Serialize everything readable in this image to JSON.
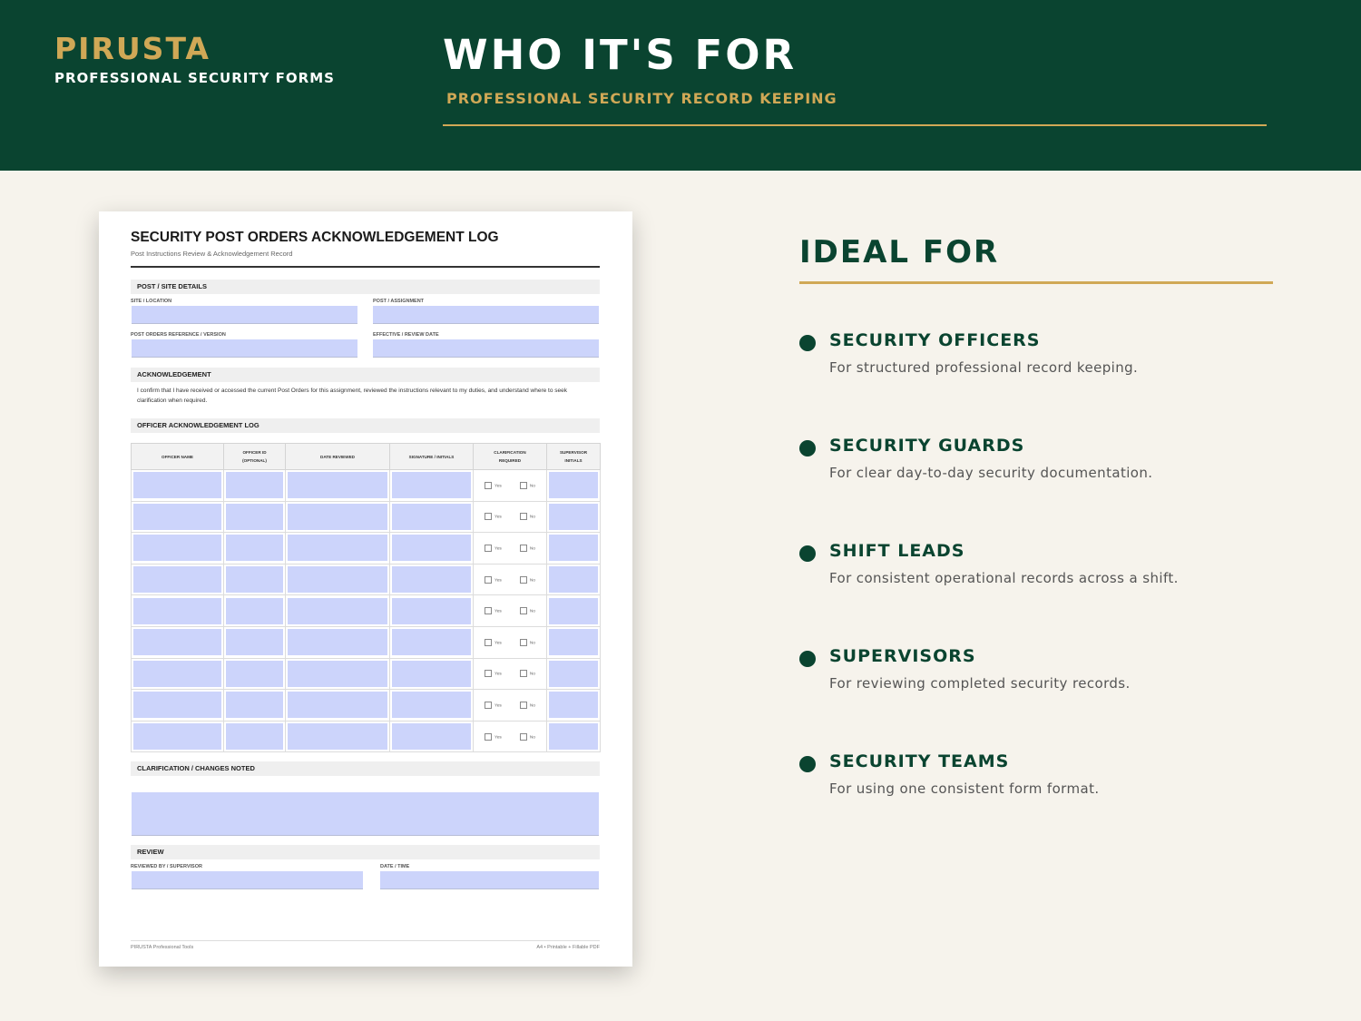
{
  "header": {
    "brand": "PIRUSTA",
    "brand_sub": "PROFESSIONAL SECURITY FORMS",
    "title": "WHO IT'S FOR",
    "subtitle": "PROFESSIONAL SECURITY RECORD KEEPING"
  },
  "form": {
    "title": "SECURITY POST ORDERS ACKNOWLEDGEMENT LOG",
    "subtitle": "Post Instructions Review & Acknowledgement Record",
    "section_post": "POST / SITE DETAILS",
    "label_site": "SITE / LOCATION",
    "label_post": "POST / ASSIGNMENT",
    "label_ref": "POST ORDERS REFERENCE / VERSION",
    "label_eff": "EFFECTIVE / REVIEW DATE",
    "section_ack": "ACKNOWLEDGEMENT",
    "ack_text": "I confirm that I have received or accessed the current Post Orders for this assignment, reviewed the instructions relevant to my duties, and understand where to seek clarification when required.",
    "section_log": "OFFICER ACKNOWLEDGEMENT LOG",
    "columns": {
      "officer_name": "OFFICER NAME",
      "officer_id": "OFFICER ID",
      "officer_id_note": "(OPTIONAL)",
      "date_reviewed": "DATE REVIEWED",
      "signature": "SIGNATURE / INITIALS",
      "clarification": "CLARIFICATION",
      "clarification_2": "REQUIRED",
      "supervisor": "SUPERVISOR",
      "supervisor_2": "INITIALS"
    },
    "yes_label": "Yes",
    "no_label": "No",
    "section_clar": "CLARIFICATION / CHANGES NOTED",
    "section_review": "REVIEW",
    "label_reviewed_by": "REVIEWED BY / SUPERVISOR",
    "label_datetime": "DATE / TIME",
    "footer_left": "PIRUSTA Professional Tools",
    "footer_right": "A4 • Printable + Fillable PDF"
  },
  "ideal": {
    "title": "IDEAL FOR",
    "items": [
      {
        "head": "SECURITY OFFICERS",
        "desc": "For structured professional record keeping."
      },
      {
        "head": "SECURITY GUARDS",
        "desc": "For clear day-to-day security documentation."
      },
      {
        "head": "SHIFT LEADS",
        "desc": "For consistent operational records across a shift."
      },
      {
        "head": "SUPERVISORS",
        "desc": "For reviewing completed security records."
      },
      {
        "head": "SECURITY TEAMS",
        "desc": "For using one consistent form format."
      }
    ]
  }
}
